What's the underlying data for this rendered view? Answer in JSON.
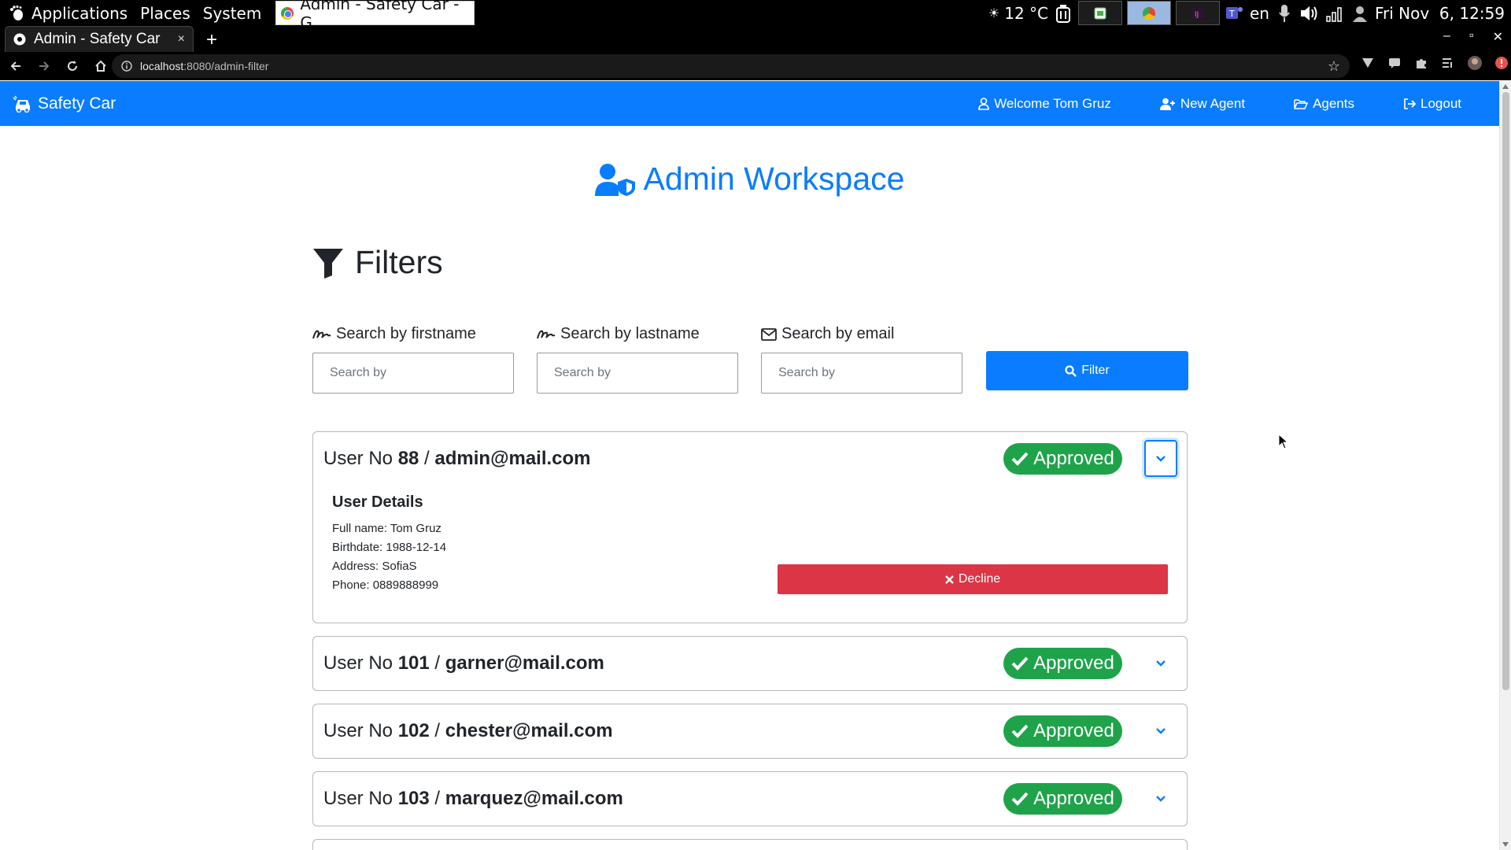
{
  "os_panel": {
    "menus": [
      "Applications",
      "Places",
      "System"
    ],
    "task_title": "Admin - Safety Car - G...",
    "weather": "12 °C",
    "language": "en",
    "clock": "Fri Nov  6, 12:59"
  },
  "browser": {
    "tab_title": "Admin - Safety Car",
    "tab_close": "×",
    "new_tab": "+",
    "url_host": "localhost",
    "url_path": ":8080/admin-filter"
  },
  "navbar": {
    "brand": "Safety Car",
    "links": [
      {
        "label": "Welcome Tom Gruz",
        "icon": "user-icon"
      },
      {
        "label": "New Agent",
        "icon": "user-plus-icon"
      },
      {
        "label": "Agents",
        "icon": "folder-open-icon"
      },
      {
        "label": "Logout",
        "icon": "sign-out-icon"
      }
    ]
  },
  "page": {
    "title": "Admin Workspace",
    "filters_heading": "Filters"
  },
  "filters": {
    "firstname_label": "Search by firstname",
    "lastname_label": "Search by lastname",
    "email_label": "Search by email",
    "placeholder": "Search by",
    "filter_button": "Filter"
  },
  "users": [
    {
      "prefix": "User No ",
      "number": "88",
      "sep": " / ",
      "email": "admin@mail.com",
      "status": "Approved",
      "expanded": true,
      "details_title": "User Details",
      "full_name": "Full name: Tom Gruz",
      "birthdate": "Birthdate: 1988-12-14",
      "address": "Address: SofiaS",
      "phone": "Phone: 0889888999",
      "action": "Decline"
    },
    {
      "prefix": "User No ",
      "number": "101",
      "sep": " / ",
      "email": "garner@mail.com",
      "status": "Approved",
      "expanded": false
    },
    {
      "prefix": "User No ",
      "number": "102",
      "sep": " / ",
      "email": "chester@mail.com",
      "status": "Approved",
      "expanded": false
    },
    {
      "prefix": "User No ",
      "number": "103",
      "sep": " / ",
      "email": "marquez@mail.com",
      "status": "Approved",
      "expanded": false
    }
  ],
  "colors": {
    "primary": "#0a7cff",
    "approved": "#1fa34a",
    "decline": "#dc3545"
  }
}
